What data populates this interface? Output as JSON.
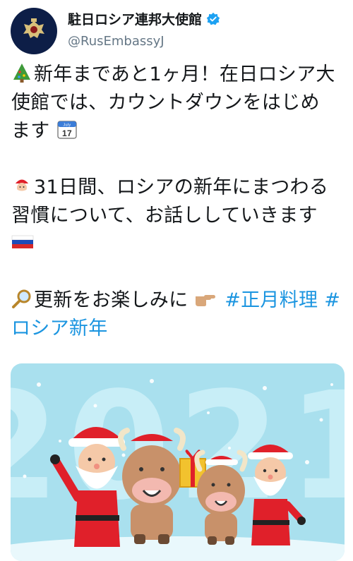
{
  "tweet": {
    "author": {
      "display_name": "駐日ロシア連邦大使館",
      "handle": "@RusEmbassyJ",
      "verified": true,
      "avatar_icon": "russian-coat-of-arms-icon"
    },
    "lines": {
      "l1": "新年まであと1ヶ月！在日ロシア大",
      "l2": "使館では、カウントダウンをはじめ",
      "l3": "ます",
      "l4": "31日間、ロシアの新年にまつわる",
      "l5": "習慣について、お話ししていきます",
      "l6_text": "更新をお楽しみに",
      "hashtag1": "#正月料理",
      "hashtag2_a": "#",
      "hashtag2_b": "ロシア新年"
    },
    "calendar_emoji": {
      "month": "July",
      "day": "17"
    },
    "emoji_icons": [
      "christmas-tree-icon",
      "calendar-icon",
      "santa-icon",
      "russian-flag-icon",
      "magnifier-icon",
      "pointing-hand-icon"
    ],
    "media": {
      "year_text": "2021",
      "description_icon": "santas-and-bulls-illustration"
    }
  },
  "colors": {
    "hashtag": "#1b95e0",
    "handle": "#657786",
    "media_bg": "#a9e0ee",
    "verified": "#1da1f2"
  }
}
